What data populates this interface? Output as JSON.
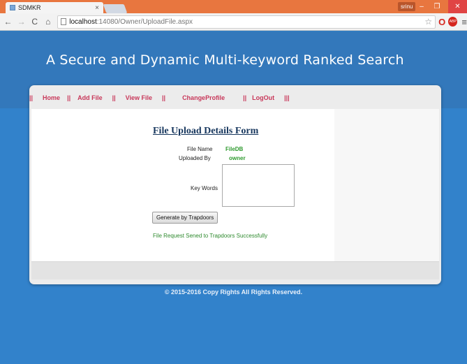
{
  "browser": {
    "tab_title": "SDMKR",
    "tab_close": "×",
    "user_badge": "srinu",
    "url_host": "localhost",
    "url_path": ":14080/Owner/UploadFile.aspx",
    "win_min": "–",
    "win_max": "❐",
    "win_close": "✕"
  },
  "site": {
    "title": "A Secure and Dynamic Multi-keyword Ranked Search"
  },
  "menu": {
    "separator": "||",
    "last_separator": "|||",
    "items": [
      {
        "label": "Home"
      },
      {
        "label": "Add File"
      },
      {
        "label": "View File"
      },
      {
        "label": "ChangeProfile"
      },
      {
        "label": "LogOut"
      }
    ]
  },
  "form": {
    "title": "File Upload Details Form",
    "file_name_label": "File Name",
    "file_name_value": "FileDB",
    "uploaded_by_label": "Uploaded By",
    "uploaded_by_value": "owner",
    "keywords_label": "Key Words",
    "keywords_value": "",
    "generate_button": "Generate by Trapdoors",
    "status_message": "File Request Sened to Trapdoors Successfully"
  },
  "footer": {
    "copyright": "© 2015-2016 Copy Rights All Rights Reserved."
  },
  "colors": {
    "accent": "#3282cb",
    "menu_link": "#c8385a",
    "success": "#2e9a2e",
    "form_title": "#17375e"
  },
  "icons": [
    "back-icon",
    "forward-icon",
    "reload-icon",
    "home-icon",
    "page-icon",
    "star-icon",
    "opera-icon",
    "adblock-icon",
    "menu-icon"
  ]
}
